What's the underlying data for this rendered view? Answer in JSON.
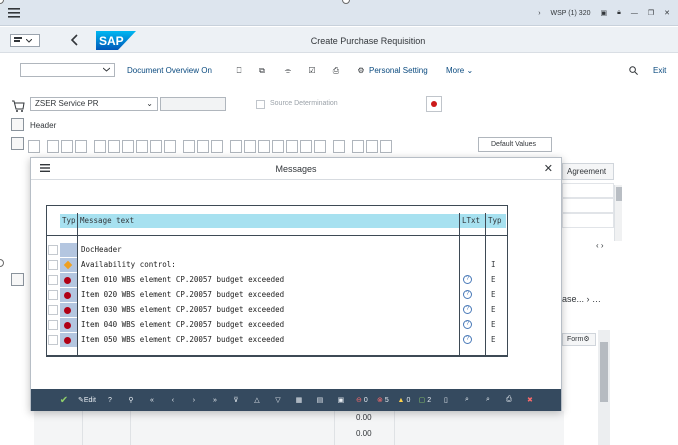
{
  "window": {
    "system": "WSP (1) 320"
  },
  "app": {
    "title": "Create Purchase Requisition",
    "logo_text": "SAP"
  },
  "toolbar": {
    "document_overview": "Document Overview On",
    "personal_setting": "Personal Setting",
    "more": "More",
    "exit": "Exit"
  },
  "form": {
    "doc_type": "ZSER Service PR",
    "source_determination": "Source Determination",
    "header_label": "Header",
    "default_values": "Default Values"
  },
  "background_table": {
    "agreement_header": "Agreement",
    "truncated_tab": "ase...",
    "form_header": "Form",
    "values": [
      "0.00",
      "0.00",
      "0.00"
    ]
  },
  "dialog": {
    "title": "Messages",
    "columns": {
      "typ": "Typ",
      "message_text": "Message text",
      "ltxt": "LTxt",
      "typ2": "Typ"
    },
    "rows": [
      {
        "icon": "none",
        "text": "DocHeader",
        "ltxt": false,
        "type": ""
      },
      {
        "icon": "warning-diamond",
        "text": "Availability control:",
        "ltxt": false,
        "type": "I"
      },
      {
        "icon": "error-dot",
        "text": "Item 010 WBS element CP.20057 budget exceeded",
        "ltxt": true,
        "type": "E"
      },
      {
        "icon": "error-dot",
        "text": "Item 020 WBS element CP.20057 budget exceeded",
        "ltxt": true,
        "type": "E"
      },
      {
        "icon": "error-dot",
        "text": "Item 030 WBS element CP.20057 budget exceeded",
        "ltxt": true,
        "type": "E"
      },
      {
        "icon": "error-dot",
        "text": "Item 040 WBS element CP.20057 budget exceeded",
        "ltxt": true,
        "type": "E"
      },
      {
        "icon": "error-dot",
        "text": "Item 050 WBS element CP.20057 budget exceeded",
        "ltxt": true,
        "type": "E"
      }
    ],
    "toolbar": {
      "edit": "Edit",
      "errors": "0",
      "stops": "5",
      "warnings": "0",
      "info": "2"
    }
  },
  "colors": {
    "shell": "#dde5ee",
    "header_cell": "#a7e1f0",
    "dialog_toolbar": "#354a5f",
    "error": "#b00016"
  }
}
